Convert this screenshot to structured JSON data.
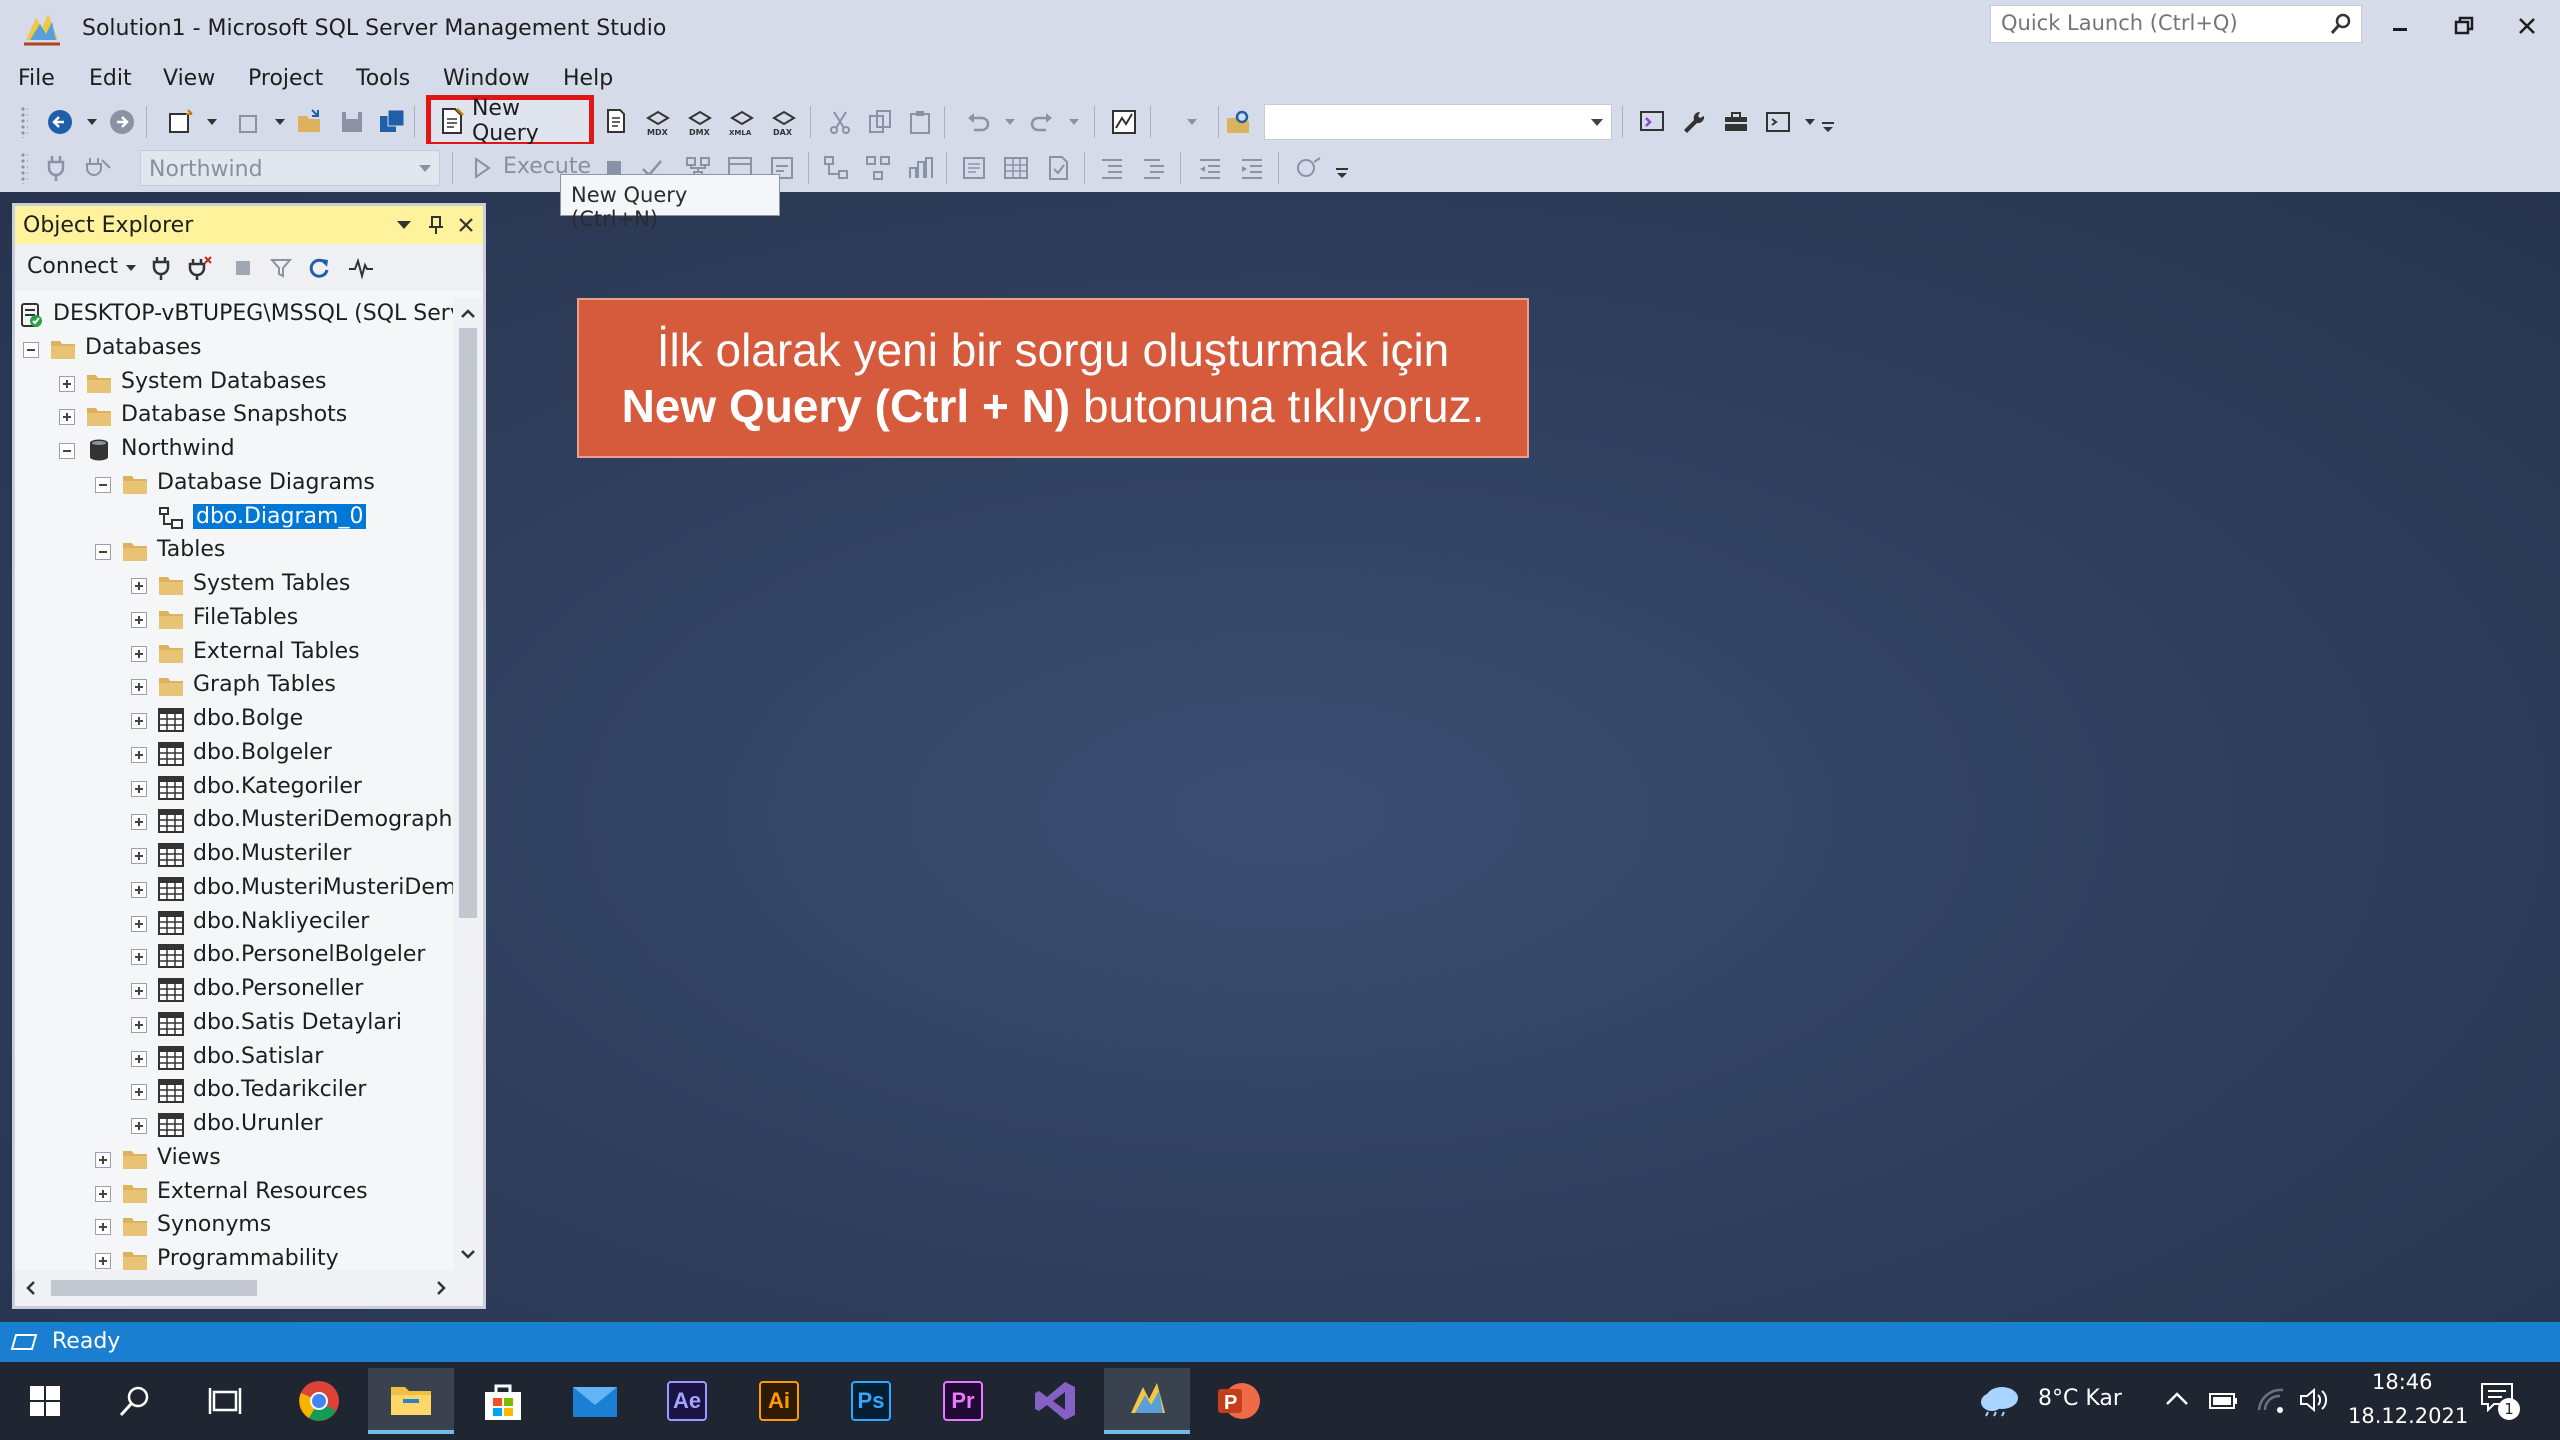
{
  "window": {
    "title": "Solution1 - Microsoft SQL Server Management Studio",
    "quick_launch_placeholder": "Quick Launch (Ctrl+Q)"
  },
  "menu": [
    "File",
    "Edit",
    "View",
    "Project",
    "Tools",
    "Window",
    "Help"
  ],
  "toolbar": {
    "new_query_label": "New Query",
    "database_combo": "Northwind",
    "execute_label": "Execute",
    "tooltip": "New Query (Ctrl+N)"
  },
  "object_explorer": {
    "title": "Object Explorer",
    "connect_label": "Connect",
    "tree": [
      {
        "label": "DESKTOP-vBTUPEG\\MSSQL (SQL Server",
        "icon": "server-icon",
        "level": 0,
        "expander": "none"
      },
      {
        "label": "Databases",
        "icon": "folder-icon",
        "level": 0,
        "expander": "minus"
      },
      {
        "label": "System Databases",
        "icon": "folder-icon",
        "level": 1,
        "expander": "plus"
      },
      {
        "label": "Database Snapshots",
        "icon": "folder-icon",
        "level": 1,
        "expander": "plus"
      },
      {
        "label": "Northwind",
        "icon": "database-icon",
        "level": 1,
        "expander": "minus"
      },
      {
        "label": "Database Diagrams",
        "icon": "folder-icon",
        "level": 2,
        "expander": "minus"
      },
      {
        "label": "dbo.Diagram_0",
        "icon": "diagram-icon",
        "level": 3,
        "expander": "none",
        "selected": true
      },
      {
        "label": "Tables",
        "icon": "folder-icon",
        "level": 2,
        "expander": "minus"
      },
      {
        "label": "System Tables",
        "icon": "folder-icon",
        "level": 3,
        "expander": "plus"
      },
      {
        "label": "FileTables",
        "icon": "folder-icon",
        "level": 3,
        "expander": "plus"
      },
      {
        "label": "External Tables",
        "icon": "folder-icon",
        "level": 3,
        "expander": "plus"
      },
      {
        "label": "Graph Tables",
        "icon": "folder-icon",
        "level": 3,
        "expander": "plus"
      },
      {
        "label": "dbo.Bolge",
        "icon": "table-icon",
        "level": 3,
        "expander": "plus"
      },
      {
        "label": "dbo.Bolgeler",
        "icon": "table-icon",
        "level": 3,
        "expander": "plus"
      },
      {
        "label": "dbo.Kategoriler",
        "icon": "table-icon",
        "level": 3,
        "expander": "plus"
      },
      {
        "label": "dbo.MusteriDemographic",
        "icon": "table-icon",
        "level": 3,
        "expander": "plus"
      },
      {
        "label": "dbo.Musteriler",
        "icon": "table-icon",
        "level": 3,
        "expander": "plus"
      },
      {
        "label": "dbo.MusteriMusteriDemo",
        "icon": "table-icon",
        "level": 3,
        "expander": "plus"
      },
      {
        "label": "dbo.Nakliyeciler",
        "icon": "table-icon",
        "level": 3,
        "expander": "plus"
      },
      {
        "label": "dbo.PersonelBolgeler",
        "icon": "table-icon",
        "level": 3,
        "expander": "plus"
      },
      {
        "label": "dbo.Personeller",
        "icon": "table-icon",
        "level": 3,
        "expander": "plus"
      },
      {
        "label": "dbo.Satis Detaylari",
        "icon": "table-icon",
        "level": 3,
        "expander": "plus"
      },
      {
        "label": "dbo.Satislar",
        "icon": "table-icon",
        "level": 3,
        "expander": "plus"
      },
      {
        "label": "dbo.Tedarikciler",
        "icon": "table-icon",
        "level": 3,
        "expander": "plus"
      },
      {
        "label": "dbo.Urunler",
        "icon": "table-icon",
        "level": 3,
        "expander": "plus"
      },
      {
        "label": "Views",
        "icon": "folder-icon",
        "level": 2,
        "expander": "plus"
      },
      {
        "label": "External Resources",
        "icon": "folder-icon",
        "level": 2,
        "expander": "plus"
      },
      {
        "label": "Synonyms",
        "icon": "folder-icon",
        "level": 2,
        "expander": "plus"
      },
      {
        "label": "Programmability",
        "icon": "folder-icon",
        "level": 2,
        "expander": "plus"
      }
    ]
  },
  "callout": {
    "line1": "İlk olarak yeni bir sorgu oluşturmak için",
    "line2_bold": "New Query (Ctrl + N)",
    "line2_rest": " butonuna tıklıyoruz."
  },
  "status": {
    "text": "Ready"
  },
  "taskbar": {
    "apps": [
      {
        "name": "start-button",
        "label": ""
      },
      {
        "name": "search-button",
        "label": ""
      },
      {
        "name": "task-view-button",
        "label": ""
      },
      {
        "name": "chrome-app",
        "label": ""
      },
      {
        "name": "file-explorer-app",
        "label": ""
      },
      {
        "name": "store-app",
        "label": ""
      },
      {
        "name": "mail-app",
        "label": ""
      },
      {
        "name": "after-effects-app",
        "label": "Ae"
      },
      {
        "name": "illustrator-app",
        "label": "Ai"
      },
      {
        "name": "photoshop-app",
        "label": "Ps"
      },
      {
        "name": "premiere-app",
        "label": "Pr"
      },
      {
        "name": "visual-studio-app",
        "label": ""
      },
      {
        "name": "ssms-app",
        "label": ""
      },
      {
        "name": "powerpoint-app",
        "label": ""
      }
    ],
    "weather": "8°C Kar",
    "time": "18:46",
    "date": "18.12.2021",
    "notification_count": "1"
  },
  "colors": {
    "highlight_box": "#e01515",
    "callout_bg": "#d65a3c",
    "status_bar": "#1a7fd0",
    "selection": "#0078d7",
    "oe_header": "#fff29d"
  }
}
